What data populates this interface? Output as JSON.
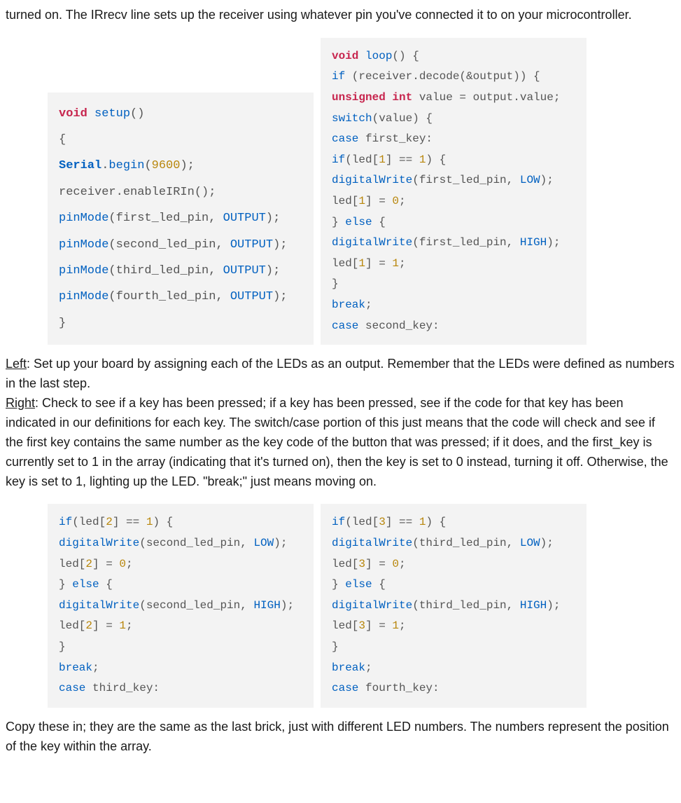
{
  "para1": "turned on. The IRrecv line sets up the receiver using whatever pin you've connected it to on your microcontroller.",
  "para2_left_label": "Left",
  "para2_left": ": Set up your board by assigning each of the LEDs as an output. Remember that the LEDs were defined as numbers in the last step.",
  "para2_right_label": "Right",
  "para2_right": ": Check to see if a key has been pressed; if a key has been pressed, see if the code for that key has been indicated in our definitions for each key. The switch/case portion of this just means that the code will check and see if the first key contains the same number as the key code of the button that was pressed; if it does, and the first_key is currently set to 1 in the array (indicating that it's turned on), then the key is set to 0 instead, turning it off. Otherwise, the key is set to 1, lighting up the LED. \"break;\" just means moving on.",
  "para3": "Copy these in; they are the same as the last brick, just with different LED numbers. The numbers represent the position of the key within the array.",
  "code": {
    "setup": {
      "void": "void",
      "setup": "setup",
      "po": "()",
      "ob": "{",
      "serial": "Serial",
      "dot": ".",
      "begin": "begin",
      "p9600a": "(",
      "n9600": "9600",
      "p9600b": ");",
      "recv": "receiver.enableIRIn();",
      "pm": "pinMode",
      "pm1a": "(first_led_pin, ",
      "out": "OUTPUT",
      "pmend": ");",
      "pm2a": "(second_led_pin, ",
      "pm3a": "(third_led_pin, ",
      "pm4a": "(fourth_led_pin, ",
      "cb": "}"
    },
    "loop": {
      "void": "void",
      "loop": "loop",
      "po": "() {",
      "if": "if",
      "ifdec": " (receiver.decode(&output)) {",
      "uint": "unsigned int",
      "valassign": " value = output.value;",
      "switch": "switch",
      "swval": "(value) {",
      "case": "case",
      "case1": " first_key:",
      "ifled1a": "(led[",
      "n1a": "1",
      "ifled1b": "] == ",
      "n1b": "1",
      "ifled1c": ") {",
      "dw": "digitalWrite",
      "dw1low": "(first_led_pin, ",
      "low": "LOW",
      "dwend": ");",
      "led1a": "led[",
      "n1c": "1",
      "led1b": "] = ",
      "n0": "0",
      "semi": ";",
      "cbrace": "}",
      "else": "else",
      "ob2": " {",
      "dw1high": "(first_led_pin, ",
      "high": "HIGH",
      "led1c": "led[",
      "n1d": "1",
      "led1d": "] = ",
      "n1e": "1",
      "break": "break",
      "case2": " second_key:"
    },
    "mid2": {
      "if": "if",
      "ifleda": "(led[",
      "n2a": "2",
      "ifledb": "] == ",
      "n1": "1",
      "ifledc": ") {",
      "dw": "digitalWrite",
      "dwlow": "(second_led_pin, ",
      "low": "LOW",
      "dwend": ");",
      "leda": "led[",
      "n2b": "2",
      "ledb": "] = ",
      "n0": "0",
      "semi": ";",
      "cbrace": "}",
      "else": "else",
      "ob": " {",
      "dwhigh": "(second_led_pin, ",
      "high": "HIGH",
      "n2c": "2",
      "n1b": "1",
      "break": "break",
      "case": "case",
      "casek": " third_key:"
    },
    "mid3": {
      "if": "if",
      "ifleda": "(led[",
      "n3a": "3",
      "ifledb": "] == ",
      "n1": "1",
      "ifledc": ") {",
      "dw": "digitalWrite",
      "dwlow": "(third_led_pin, ",
      "low": "LOW",
      "dwend": ");",
      "leda": "led[",
      "n3b": "3",
      "ledb": "] = ",
      "n0": "0",
      "semi": ";",
      "cbrace": "}",
      "else": "else",
      "ob": " {",
      "dwhigh": "(third_led_pin, ",
      "high": "HIGH",
      "n3c": "3",
      "n1b": "1",
      "break": "break",
      "case": "case",
      "casek": " fourth_key:"
    }
  }
}
